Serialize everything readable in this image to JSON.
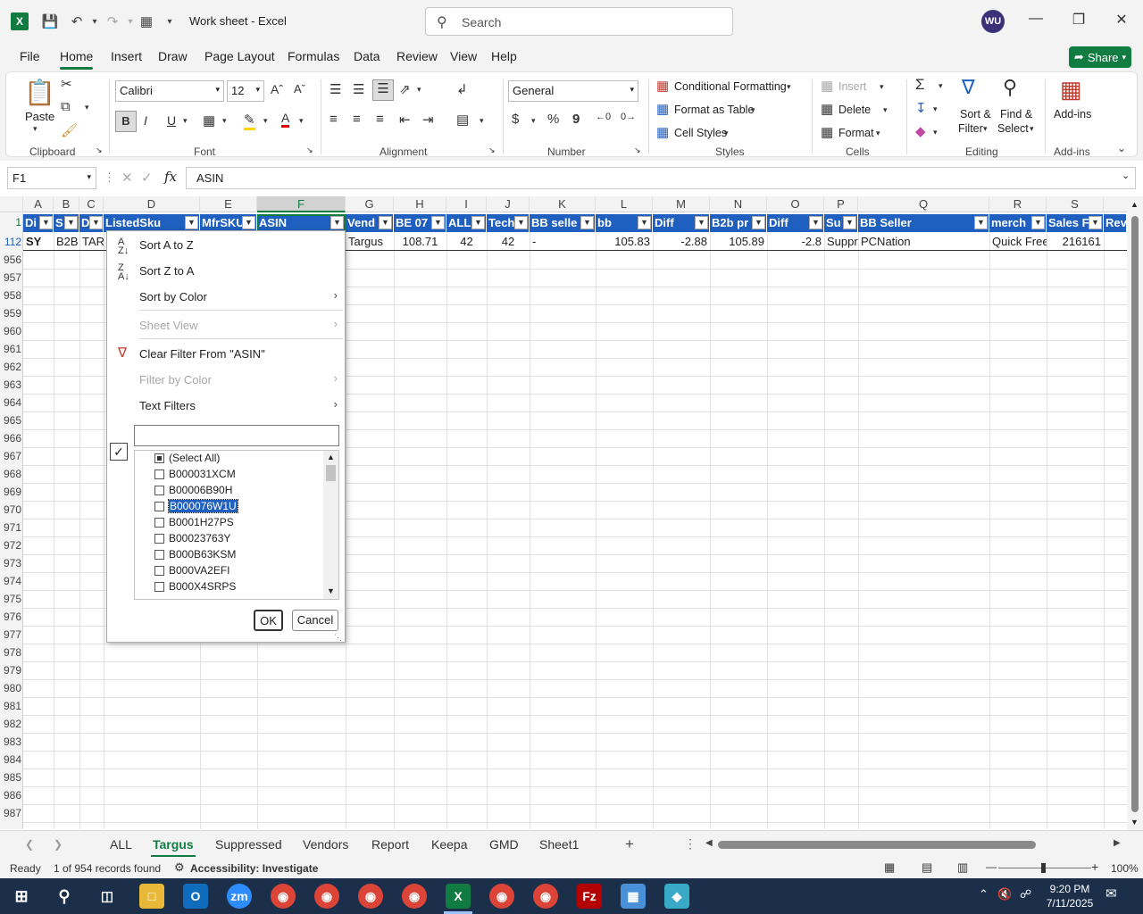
{
  "app": {
    "doc_title": "Work sheet  -  Excel",
    "search_label": "Search",
    "user_initials": "WU"
  },
  "menu": {
    "tabs": [
      "File",
      "Home",
      "Insert",
      "Draw",
      "Page Layout",
      "Formulas",
      "Data",
      "Review",
      "View",
      "Help"
    ],
    "share_label": "Share"
  },
  "ribbon": {
    "clipboard": {
      "paste": "Paste",
      "label": "Clipboard"
    },
    "font": {
      "name": "Calibri",
      "size": "12",
      "bold": "B",
      "italic": "I",
      "underline": "U",
      "label": "Font"
    },
    "alignment": {
      "label": "Alignment"
    },
    "number": {
      "format": "General",
      "label": "Number",
      "currency": "$",
      "percent": "%",
      "comma": "9"
    },
    "styles": {
      "cond_fmt": "Conditional Formatting",
      "fmt_table": "Format as Table",
      "cell_styles": "Cell Styles",
      "label": "Styles"
    },
    "cells": {
      "insert": "Insert",
      "delete": "Delete",
      "format": "Format",
      "label": "Cells"
    },
    "editing": {
      "sort_filter_1": "Sort &",
      "sort_filter_2": "Filter",
      "find_select_1": "Find &",
      "find_select_2": "Select",
      "label": "Editing"
    },
    "addins": {
      "btn": "Add-ins",
      "label": "Add-ins"
    }
  },
  "formula_bar": {
    "name_box": "F1",
    "fx": "fx",
    "value": "ASIN"
  },
  "grid": {
    "columns": [
      "A",
      "B",
      "C",
      "D",
      "E",
      "F",
      "G",
      "H",
      "I",
      "J",
      "K",
      "L",
      "M",
      "N",
      "O",
      "P",
      "Q",
      "R",
      "S"
    ],
    "row_numbers": [
      "1",
      "112",
      "956",
      "957",
      "958",
      "959",
      "960",
      "961",
      "962",
      "963",
      "964",
      "965",
      "966",
      "967",
      "968",
      "969",
      "970",
      "971",
      "972",
      "973",
      "974",
      "975",
      "976",
      "977",
      "978",
      "979",
      "980",
      "981",
      "982",
      "983",
      "984",
      "985",
      "986",
      "987"
    ],
    "header_row": [
      "Di",
      "S",
      "D",
      "ListedSku",
      "MfrSKU",
      "ASIN",
      "Vend",
      "BE 07",
      "ALL",
      "Tech",
      "BB selle",
      "bb",
      "Diff",
      "B2b pr",
      "Diff",
      "Su",
      "BB Seller",
      "merch",
      "Sales F",
      "Rev"
    ],
    "data_row": [
      "SY",
      "B2B",
      "TAR",
      "",
      "",
      "",
      "Targus",
      "108.71",
      "42",
      "42",
      "-",
      "105.83",
      "-2.88",
      "105.89",
      "-2.8",
      "Suppr",
      "PCNation",
      "Quick Free",
      "216161",
      ""
    ]
  },
  "filter_menu": {
    "sort_az": "Sort A to Z",
    "sort_za": "Sort Z to A",
    "sort_color": "Sort by Color",
    "sheet_view": "Sheet View",
    "clear_filter": "Clear Filter From \"ASIN\"",
    "filter_color": "Filter by Color",
    "text_filters": "Text Filters",
    "search_value": "",
    "list": [
      "(Select All)",
      "B000031XCM",
      "B00006B90H",
      "B000076W1U",
      "B0001H27PS",
      "B00023763Y",
      "B000B63KSM",
      "B000VA2EFI",
      "B000X4SRPS"
    ],
    "ok": "OK",
    "cancel": "Cancel"
  },
  "sheets": {
    "tabs": [
      "ALL",
      "Targus",
      "Suppressed",
      "Vendors",
      "Report",
      "Keepa",
      "GMD",
      "Sheet1"
    ],
    "active": "Targus"
  },
  "status": {
    "ready": "Ready",
    "records": "1 of 954 records found",
    "accessibility": "Accessibility: Investigate",
    "zoom": "100%"
  },
  "clock": {
    "time": "9:20 PM",
    "date": "7/11/2025"
  },
  "colors": {
    "excel_green": "#107c41",
    "header_blue": "#1f5fbf",
    "taskbar": "#1c2f4a"
  }
}
